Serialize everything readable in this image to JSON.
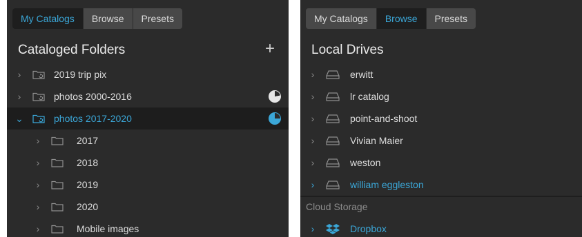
{
  "left": {
    "tabs": [
      {
        "label": "My Catalogs",
        "active": true
      },
      {
        "label": "Browse",
        "active": false
      },
      {
        "label": "Presets",
        "active": false
      }
    ],
    "section_title": "Cataloged Folders",
    "add_label": "+",
    "folders": [
      {
        "label": "2019 trip pix",
        "expanded": false
      },
      {
        "label": "photos 2000-2016",
        "expanded": false,
        "progress": 0.78
      },
      {
        "label": "photos 2017-2020",
        "expanded": true,
        "selected": true,
        "progress": 0.75
      }
    ],
    "subfolders": [
      {
        "label": "2017"
      },
      {
        "label": "2018"
      },
      {
        "label": "2019"
      },
      {
        "label": "2020"
      },
      {
        "label": "Mobile images"
      }
    ]
  },
  "right": {
    "tabs": [
      {
        "label": "My Catalogs",
        "active": false
      },
      {
        "label": "Browse",
        "active": true
      },
      {
        "label": "Presets",
        "active": false
      }
    ],
    "section_title": "Local Drives",
    "drives": [
      {
        "label": "erwitt"
      },
      {
        "label": "lr catalog"
      },
      {
        "label": "point-and-shoot"
      },
      {
        "label": "Vivian Maier"
      },
      {
        "label": "weston"
      },
      {
        "label": "william eggleston",
        "highlighted": true
      }
    ],
    "cloud_header": "Cloud Storage",
    "cloud": [
      {
        "label": "Dropbox",
        "icon": "dropbox-icon"
      }
    ]
  },
  "colors": {
    "accent": "#3ba7d8",
    "panel_bg": "#2b2b2b",
    "selected_bg": "#1d1d1d"
  }
}
